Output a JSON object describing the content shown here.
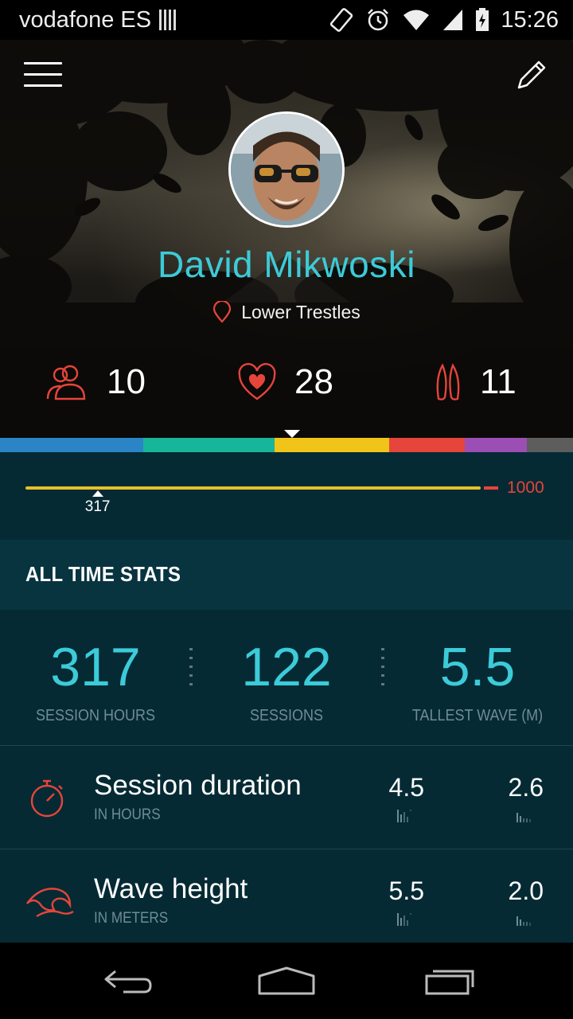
{
  "status_bar": {
    "carrier": "vodafone ES",
    "time": "15:26",
    "icons": [
      "sim-icon",
      "screen-rotation-icon",
      "alarm-icon",
      "wifi-icon",
      "signal-icon",
      "battery-charging-icon"
    ]
  },
  "header": {
    "menu_icon": "hamburger-menu-icon",
    "edit_icon": "pencil-icon"
  },
  "profile": {
    "name": "David Mikwoski",
    "location": "Lower Trestles",
    "location_icon": "map-pin-icon",
    "stats": [
      {
        "icon": "friends-icon",
        "value": "10"
      },
      {
        "icon": "heart-badge-icon",
        "value": "28"
      },
      {
        "icon": "surfboard-icon",
        "value": "11"
      }
    ]
  },
  "level_band": {
    "colors": [
      "#2a84c6",
      "#17b59a",
      "#f0c419",
      "#e5453a",
      "#9b4fb5",
      "#5d5d5d"
    ]
  },
  "progress": {
    "current": "317",
    "max": "1000",
    "fraction": 0.317,
    "track_color": "#e6c02b",
    "end_color": "#e5453a"
  },
  "all_time": {
    "title": "ALL TIME STATS",
    "stats": [
      {
        "value": "317",
        "label": "SESSION HOURS"
      },
      {
        "value": "122",
        "label": "SESSIONS"
      },
      {
        "value": "5.5",
        "label": "TALLEST WAVE (M)"
      }
    ]
  },
  "metrics": [
    {
      "icon": "stopwatch-icon",
      "title": "Session duration",
      "subtitle": "IN HOURS",
      "value_a": "4.5",
      "value_b": "2.6"
    },
    {
      "icon": "wave-icon",
      "title": "Wave height",
      "subtitle": "IN METERS",
      "value_a": "5.5",
      "value_b": "2.0"
    }
  ],
  "nav": {
    "back_icon": "back-icon",
    "home_icon": "home-icon",
    "recents_icon": "recent-apps-icon"
  },
  "colors": {
    "accent": "#3ccbd8",
    "alert": "#e5453a",
    "panel": "#052a34",
    "panel_header": "#083440",
    "muted": "#6f8c94"
  }
}
